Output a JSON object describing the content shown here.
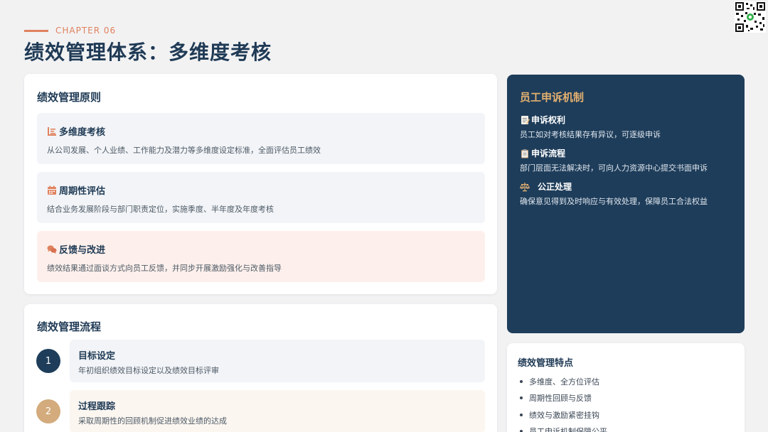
{
  "header": {
    "chapter": "CHAPTER 06",
    "title": "绩效管理体系：多维度考核"
  },
  "principles": {
    "title": "绩效管理原则",
    "items": [
      {
        "icon": "list-icon",
        "title": "多维度考核",
        "desc": "从公司发展、个人业绩、工作能力及潜力等多维度设定标准，全面评估员工绩效"
      },
      {
        "icon": "calendar-icon",
        "title": "周期性评估",
        "desc": "结合业务发展阶段与部门职责定位，实施季度、半年度及年度考核"
      },
      {
        "icon": "chat-icon",
        "title": "反馈与改进",
        "desc": "绩效结果通过面谈方式向员工反馈，并同步开展激励强化与改善指导"
      }
    ]
  },
  "process": {
    "title": "绩效管理流程",
    "steps": [
      {
        "num": "1",
        "title": "目标设定",
        "desc": "年初组织绩效目标设定以及绩效目标评审"
      },
      {
        "num": "2",
        "title": "过程跟踪",
        "desc": "采取周期性的回顾机制促进绩效业绩的达成"
      }
    ]
  },
  "appeal": {
    "title": "员工申诉机制",
    "items": [
      {
        "icon": "memo-icon",
        "title": "申诉权利",
        "desc": "员工如对考核结果存有异议，可逐级申诉"
      },
      {
        "icon": "clipboard-icon",
        "title": "申诉流程",
        "desc": "部门层面无法解决时，可向人力资源中心提交书面申诉"
      },
      {
        "icon": "scales-icon",
        "title": "公正处理",
        "desc": "确保意见得到及时响应与有效处理，保障员工合法权益"
      }
    ]
  },
  "features": {
    "title": "绩效管理特点",
    "items": [
      "多维度、全方位评估",
      "周期性回顾与反馈",
      "绩效与激励紧密挂钩",
      "员工申诉机制保障公平"
    ]
  },
  "colors": {
    "accent": "#e0825e",
    "navy": "#1f3a55",
    "panel": "#1e3d5a",
    "gold": "#e3b070",
    "step1": "#1e3d5a",
    "step2": "#d3ab7c"
  }
}
